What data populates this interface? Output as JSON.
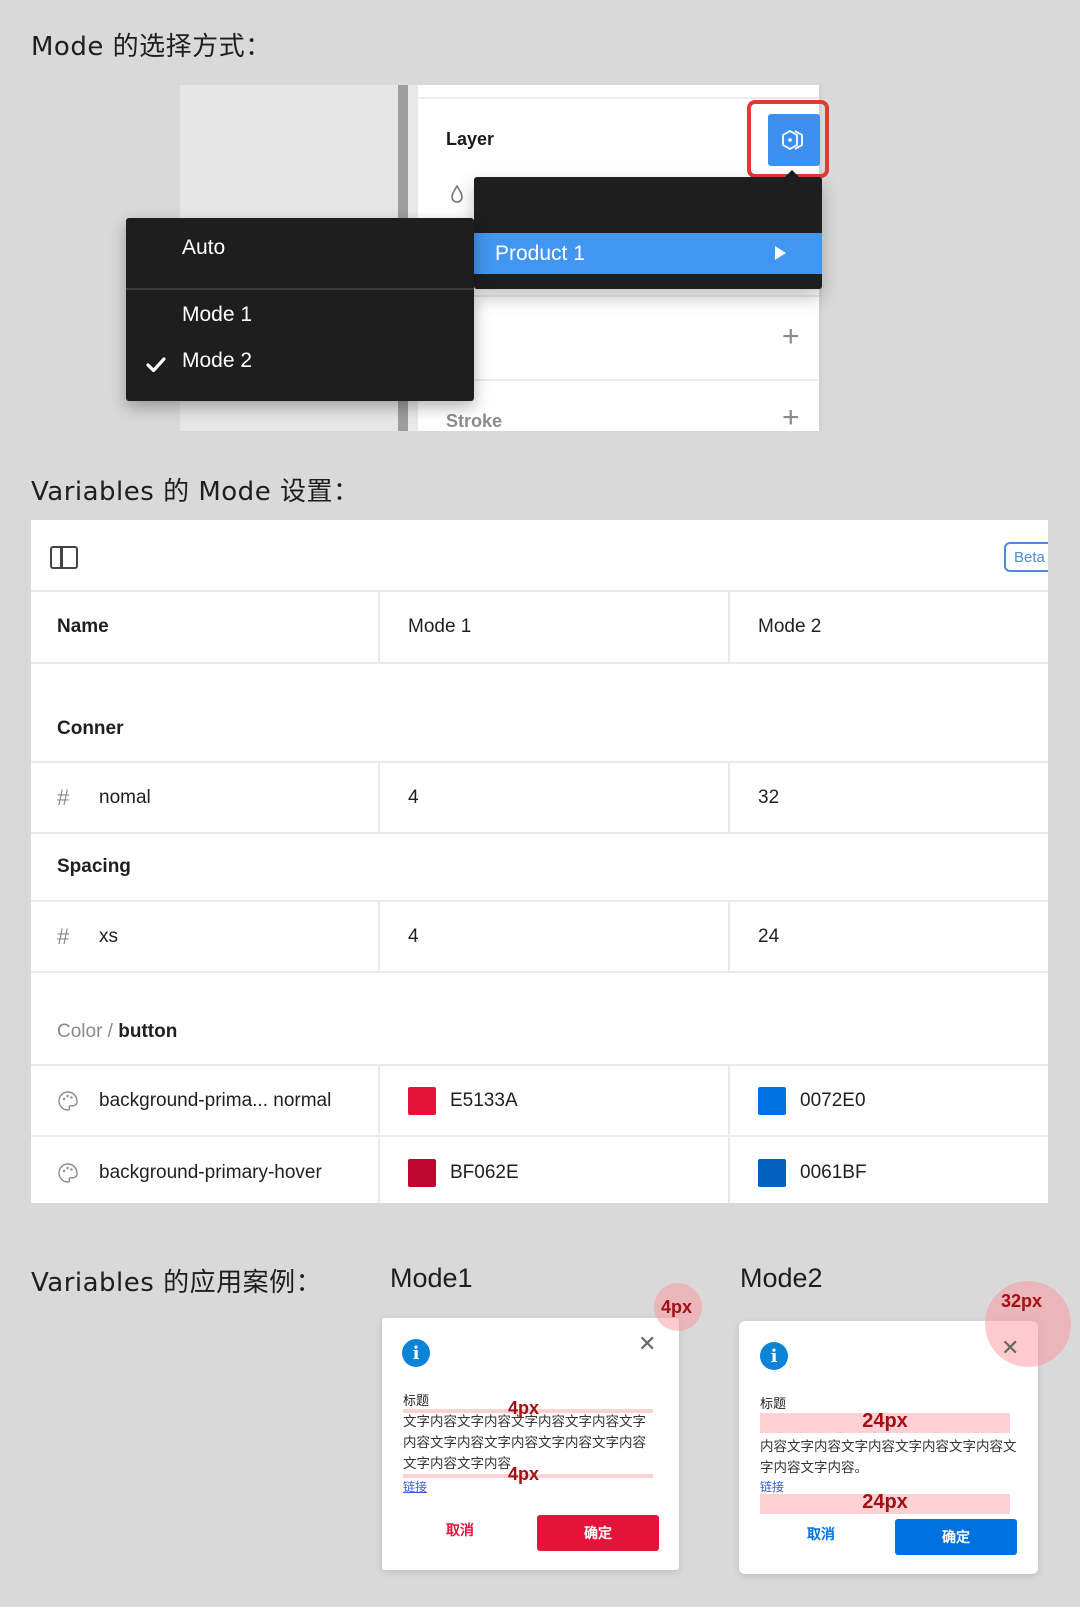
{
  "sections": {
    "mode_selection_title": "Mode 的选择方式：",
    "variables_mode_title": "Variables 的 Mode 设置：",
    "variables_usage_title": "Variables 的应用案例："
  },
  "mode_picker": {
    "panel_label": "Layer",
    "stroke_label": "Stroke",
    "mode_button_icon": "variable-mode-icon",
    "highlight_color": "#e03a33",
    "collection_menu": {
      "items": [
        {
          "label": "Product 1",
          "selected": true,
          "has_submenu": true
        }
      ]
    },
    "mode_menu": {
      "items": [
        {
          "label": "Auto",
          "checked": false
        },
        {
          "label": "Mode 1",
          "checked": false
        },
        {
          "label": "Mode 2",
          "checked": true
        }
      ]
    }
  },
  "variables_table": {
    "badge": "Beta",
    "columns": [
      "Name",
      "Mode 1",
      "Mode 2"
    ],
    "groups": [
      {
        "label": "Conner",
        "rows": [
          {
            "icon": "hash-icon",
            "name": "nomal",
            "mode1": "4",
            "mode2": "32"
          }
        ]
      },
      {
        "label": "Spacing",
        "rows": [
          {
            "icon": "hash-icon",
            "name": "xs",
            "mode1": "4",
            "mode2": "24"
          }
        ]
      },
      {
        "label_prefix": "Color / ",
        "label": "button",
        "rows": [
          {
            "icon": "palette-icon",
            "name": "background-prima... normal",
            "mode1": "E5133A",
            "mode1_color": "#E5133A",
            "mode2": "0072E0",
            "mode2_color": "#0072E0"
          },
          {
            "icon": "palette-icon",
            "name": "background-primary-hover",
            "mode1": "BF062E",
            "mode1_color": "#BF062E",
            "mode2": "0061BF",
            "mode2_color": "#0061BF"
          }
        ]
      }
    ]
  },
  "examples": [
    {
      "title": "Mode1",
      "radius_label": "4px",
      "spacing_label_top": "4px",
      "spacing_label_bottom": "4px",
      "dialog": {
        "title": "标题",
        "body": "文字内容文字内容文字内容文字内容文字内容文字内容文字内容文字内容文字内容文字内容文字内容",
        "link": "链接",
        "cancel": "取消",
        "ok": "确定",
        "accent": "#E5133A"
      }
    },
    {
      "title": "Mode2",
      "radius_label": "32px",
      "spacing_label_top": "24px",
      "spacing_label_bottom": "24px",
      "dialog": {
        "title": "标题",
        "body": "内容文字内容文字内容文字内容文字内容文字内容文字内容。",
        "link": "链接",
        "cancel": "取消",
        "ok": "确定",
        "accent": "#0072E0"
      }
    }
  ]
}
